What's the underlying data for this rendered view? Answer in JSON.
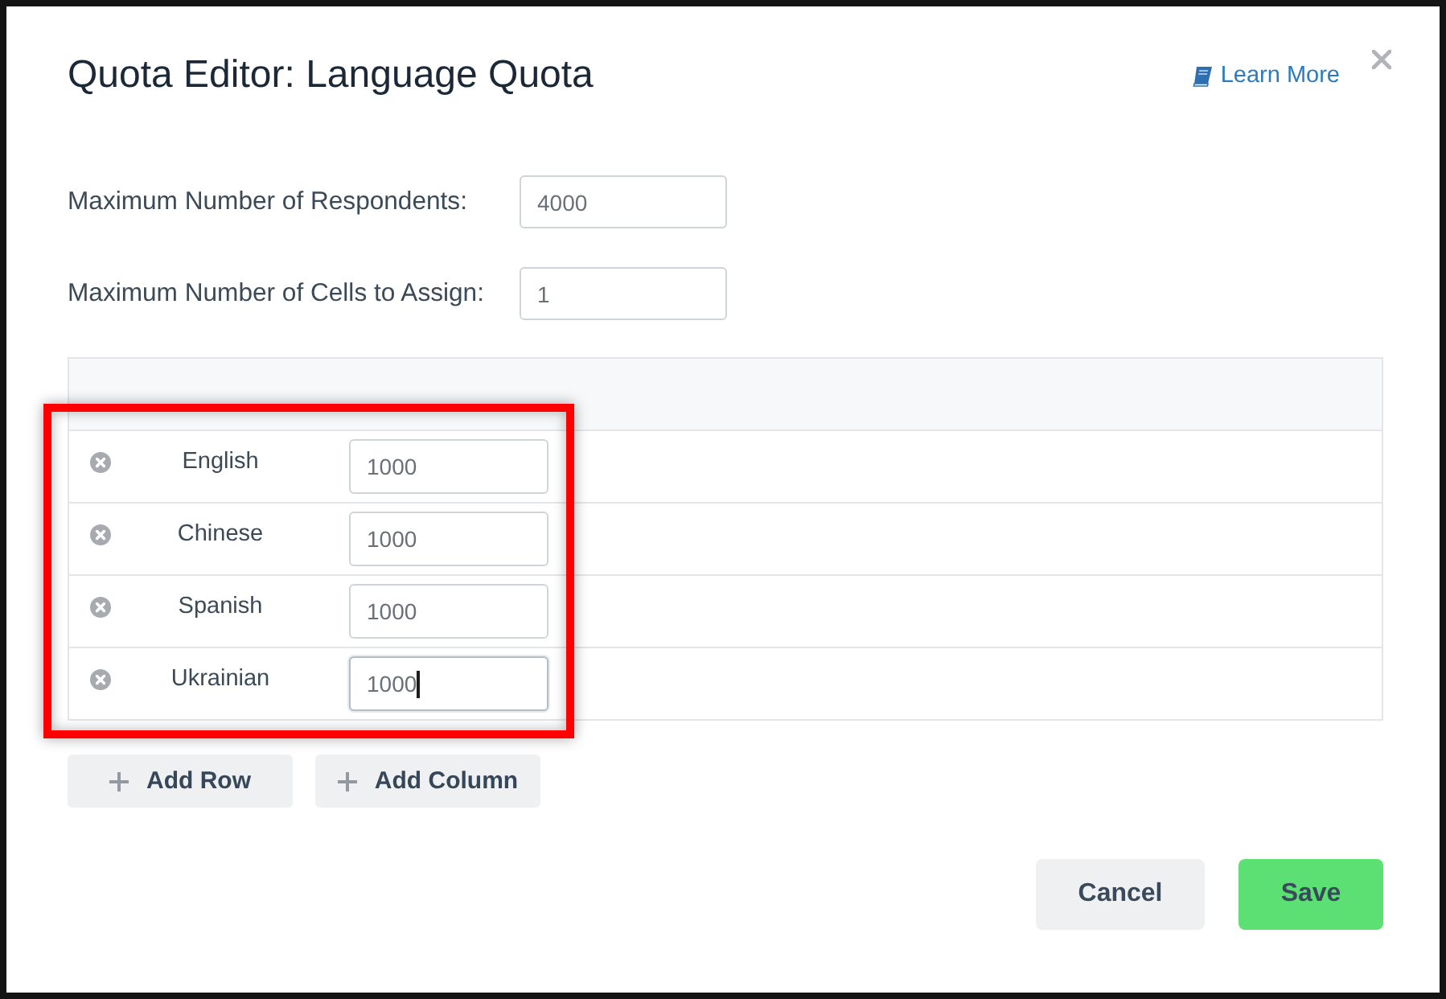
{
  "dialog": {
    "title": "Quota Editor: Language Quota",
    "help_link": "Learn More"
  },
  "fields": [
    {
      "label": "Maximum Number of Respondents:",
      "value": "4000"
    },
    {
      "label": "Maximum Number of Cells to Assign:",
      "value": "1"
    }
  ],
  "quota_table": {
    "highlighted": true,
    "rows": [
      {
        "label": "English",
        "value": "1000",
        "focused": false
      },
      {
        "label": "Chinese",
        "value": "1000",
        "focused": false
      },
      {
        "label": "Spanish",
        "value": "1000",
        "focused": false
      },
      {
        "label": "Ukrainian",
        "value": "1000",
        "focused": true
      }
    ]
  },
  "table_actions": [
    {
      "label": "Add Row"
    },
    {
      "label": "Add Column"
    }
  ],
  "footer_buttons": [
    {
      "label": "Cancel",
      "kind": "secondary"
    },
    {
      "label": "Save",
      "kind": "primary"
    }
  ]
}
